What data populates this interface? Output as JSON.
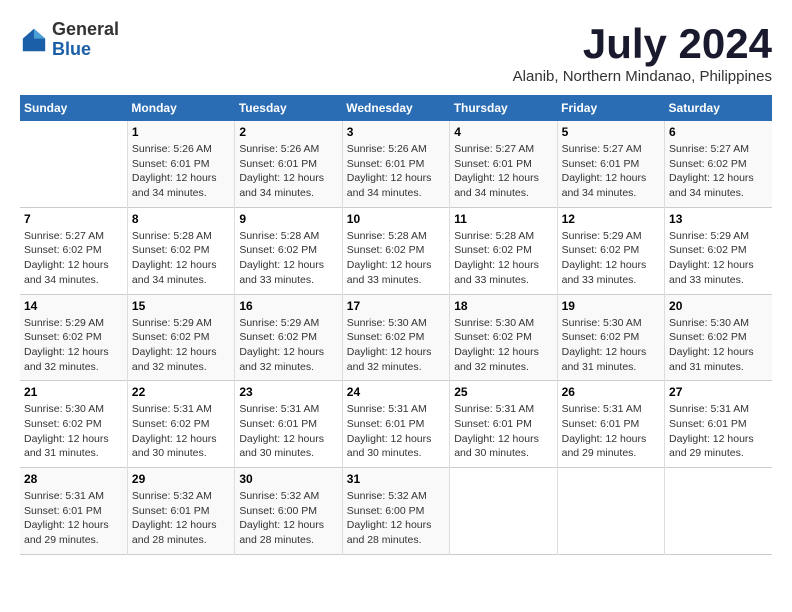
{
  "logo": {
    "general": "General",
    "blue": "Blue"
  },
  "title": "July 2024",
  "subtitle": "Alanib, Northern Mindanao, Philippines",
  "days_header": [
    "Sunday",
    "Monday",
    "Tuesday",
    "Wednesday",
    "Thursday",
    "Friday",
    "Saturday"
  ],
  "weeks": [
    [
      {
        "day": "",
        "sunrise": "",
        "sunset": "",
        "daylight": ""
      },
      {
        "day": "1",
        "sunrise": "Sunrise: 5:26 AM",
        "sunset": "Sunset: 6:01 PM",
        "daylight": "Daylight: 12 hours and 34 minutes."
      },
      {
        "day": "2",
        "sunrise": "Sunrise: 5:26 AM",
        "sunset": "Sunset: 6:01 PM",
        "daylight": "Daylight: 12 hours and 34 minutes."
      },
      {
        "day": "3",
        "sunrise": "Sunrise: 5:26 AM",
        "sunset": "Sunset: 6:01 PM",
        "daylight": "Daylight: 12 hours and 34 minutes."
      },
      {
        "day": "4",
        "sunrise": "Sunrise: 5:27 AM",
        "sunset": "Sunset: 6:01 PM",
        "daylight": "Daylight: 12 hours and 34 minutes."
      },
      {
        "day": "5",
        "sunrise": "Sunrise: 5:27 AM",
        "sunset": "Sunset: 6:01 PM",
        "daylight": "Daylight: 12 hours and 34 minutes."
      },
      {
        "day": "6",
        "sunrise": "Sunrise: 5:27 AM",
        "sunset": "Sunset: 6:02 PM",
        "daylight": "Daylight: 12 hours and 34 minutes."
      }
    ],
    [
      {
        "day": "7",
        "sunrise": "Sunrise: 5:27 AM",
        "sunset": "Sunset: 6:02 PM",
        "daylight": "Daylight: 12 hours and 34 minutes."
      },
      {
        "day": "8",
        "sunrise": "Sunrise: 5:28 AM",
        "sunset": "Sunset: 6:02 PM",
        "daylight": "Daylight: 12 hours and 34 minutes."
      },
      {
        "day": "9",
        "sunrise": "Sunrise: 5:28 AM",
        "sunset": "Sunset: 6:02 PM",
        "daylight": "Daylight: 12 hours and 33 minutes."
      },
      {
        "day": "10",
        "sunrise": "Sunrise: 5:28 AM",
        "sunset": "Sunset: 6:02 PM",
        "daylight": "Daylight: 12 hours and 33 minutes."
      },
      {
        "day": "11",
        "sunrise": "Sunrise: 5:28 AM",
        "sunset": "Sunset: 6:02 PM",
        "daylight": "Daylight: 12 hours and 33 minutes."
      },
      {
        "day": "12",
        "sunrise": "Sunrise: 5:29 AM",
        "sunset": "Sunset: 6:02 PM",
        "daylight": "Daylight: 12 hours and 33 minutes."
      },
      {
        "day": "13",
        "sunrise": "Sunrise: 5:29 AM",
        "sunset": "Sunset: 6:02 PM",
        "daylight": "Daylight: 12 hours and 33 minutes."
      }
    ],
    [
      {
        "day": "14",
        "sunrise": "Sunrise: 5:29 AM",
        "sunset": "Sunset: 6:02 PM",
        "daylight": "Daylight: 12 hours and 32 minutes."
      },
      {
        "day": "15",
        "sunrise": "Sunrise: 5:29 AM",
        "sunset": "Sunset: 6:02 PM",
        "daylight": "Daylight: 12 hours and 32 minutes."
      },
      {
        "day": "16",
        "sunrise": "Sunrise: 5:29 AM",
        "sunset": "Sunset: 6:02 PM",
        "daylight": "Daylight: 12 hours and 32 minutes."
      },
      {
        "day": "17",
        "sunrise": "Sunrise: 5:30 AM",
        "sunset": "Sunset: 6:02 PM",
        "daylight": "Daylight: 12 hours and 32 minutes."
      },
      {
        "day": "18",
        "sunrise": "Sunrise: 5:30 AM",
        "sunset": "Sunset: 6:02 PM",
        "daylight": "Daylight: 12 hours and 32 minutes."
      },
      {
        "day": "19",
        "sunrise": "Sunrise: 5:30 AM",
        "sunset": "Sunset: 6:02 PM",
        "daylight": "Daylight: 12 hours and 31 minutes."
      },
      {
        "day": "20",
        "sunrise": "Sunrise: 5:30 AM",
        "sunset": "Sunset: 6:02 PM",
        "daylight": "Daylight: 12 hours and 31 minutes."
      }
    ],
    [
      {
        "day": "21",
        "sunrise": "Sunrise: 5:30 AM",
        "sunset": "Sunset: 6:02 PM",
        "daylight": "Daylight: 12 hours and 31 minutes."
      },
      {
        "day": "22",
        "sunrise": "Sunrise: 5:31 AM",
        "sunset": "Sunset: 6:02 PM",
        "daylight": "Daylight: 12 hours and 30 minutes."
      },
      {
        "day": "23",
        "sunrise": "Sunrise: 5:31 AM",
        "sunset": "Sunset: 6:01 PM",
        "daylight": "Daylight: 12 hours and 30 minutes."
      },
      {
        "day": "24",
        "sunrise": "Sunrise: 5:31 AM",
        "sunset": "Sunset: 6:01 PM",
        "daylight": "Daylight: 12 hours and 30 minutes."
      },
      {
        "day": "25",
        "sunrise": "Sunrise: 5:31 AM",
        "sunset": "Sunset: 6:01 PM",
        "daylight": "Daylight: 12 hours and 30 minutes."
      },
      {
        "day": "26",
        "sunrise": "Sunrise: 5:31 AM",
        "sunset": "Sunset: 6:01 PM",
        "daylight": "Daylight: 12 hours and 29 minutes."
      },
      {
        "day": "27",
        "sunrise": "Sunrise: 5:31 AM",
        "sunset": "Sunset: 6:01 PM",
        "daylight": "Daylight: 12 hours and 29 minutes."
      }
    ],
    [
      {
        "day": "28",
        "sunrise": "Sunrise: 5:31 AM",
        "sunset": "Sunset: 6:01 PM",
        "daylight": "Daylight: 12 hours and 29 minutes."
      },
      {
        "day": "29",
        "sunrise": "Sunrise: 5:32 AM",
        "sunset": "Sunset: 6:01 PM",
        "daylight": "Daylight: 12 hours and 28 minutes."
      },
      {
        "day": "30",
        "sunrise": "Sunrise: 5:32 AM",
        "sunset": "Sunset: 6:00 PM",
        "daylight": "Daylight: 12 hours and 28 minutes."
      },
      {
        "day": "31",
        "sunrise": "Sunrise: 5:32 AM",
        "sunset": "Sunset: 6:00 PM",
        "daylight": "Daylight: 12 hours and 28 minutes."
      },
      {
        "day": "",
        "sunrise": "",
        "sunset": "",
        "daylight": ""
      },
      {
        "day": "",
        "sunrise": "",
        "sunset": "",
        "daylight": ""
      },
      {
        "day": "",
        "sunrise": "",
        "sunset": "",
        "daylight": ""
      }
    ]
  ]
}
